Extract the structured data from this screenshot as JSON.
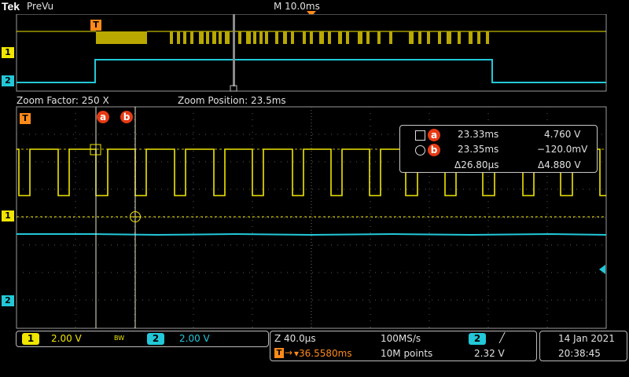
{
  "header": {
    "brand": "Tek",
    "mode": "PreVu",
    "timebase": "M 10.0ms"
  },
  "overview": {
    "trigger_marker": "T",
    "ch1_marker": "1",
    "ch2_marker": "2"
  },
  "zoom": {
    "factor_text": "Zoom Factor: 250 X",
    "position_text": "Zoom Position: 23.5ms",
    "trigger_marker": "T",
    "ch1_marker": "1",
    "ch2_marker": "2",
    "cursor_a_label": "a",
    "cursor_b_label": "b"
  },
  "cursor_readout": {
    "a_label": "a",
    "b_label": "b",
    "a_time": "23.33ms",
    "a_volt": "4.760 V",
    "b_time": "23.35ms",
    "b_volt": "−120.0mV",
    "delta_time": "Δ26.80µs",
    "delta_volt": "Δ4.880 V"
  },
  "status": {
    "ch1_num": "1",
    "ch1_scale": "2.00 V",
    "bw_flag": "BW",
    "ch2_num": "2",
    "ch2_scale": "2.00 V",
    "zoom_timebase": "Z 40.0µs",
    "sample_rate": "100MS/s",
    "trigger_source": "2",
    "trigger_slope": "╱",
    "trigger_delay": "▾36.5580ms",
    "record_length": "10M points",
    "trigger_level": "2.32 V",
    "date": "14 Jan  2021",
    "time": "20:38:45"
  },
  "colors": {
    "ch1": "#f0e600",
    "ch2": "#22c8d8",
    "cursor": "#e63a14",
    "trigger_orange": "#ff8a1a"
  }
}
